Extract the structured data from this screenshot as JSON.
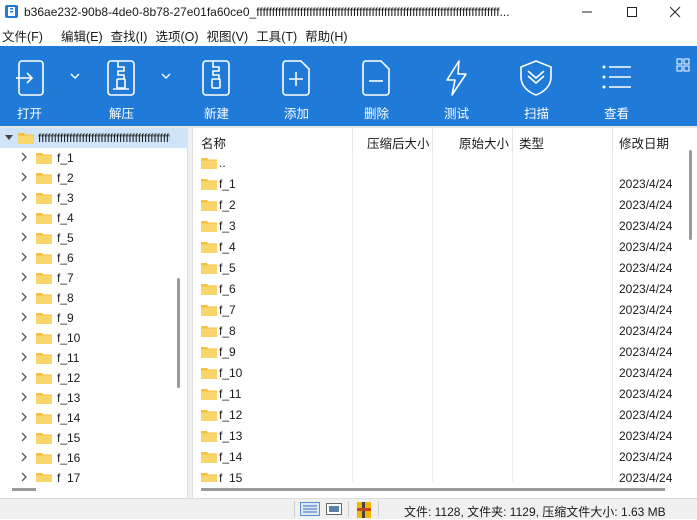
{
  "window": {
    "title": "b36ae232-90b8-4de0-8b78-27e01fa60ce0_ffffffffffffffffffffffffffffffffffffffffffffffffffffffffffffffffffffffffffffff..."
  },
  "menu": [
    "文件(F)",
    "编辑(E)",
    "查找(I)",
    "选项(O)",
    "视图(V)",
    "工具(T)",
    "帮助(H)"
  ],
  "toolbar": {
    "open": "打开",
    "extract": "解压",
    "new": "新建",
    "add": "添加",
    "delete": "删除",
    "test": "测试",
    "scan": "扫描",
    "view": "查看"
  },
  "tree": {
    "root": "ffffffffffffffffffffffffffffffffffffffffffffffff",
    "items": [
      "f_1",
      "f_2",
      "f_3",
      "f_4",
      "f_5",
      "f_6",
      "f_7",
      "f_8",
      "f_9",
      "f_10",
      "f_11",
      "f_12",
      "f_13",
      "f_14",
      "f_15",
      "f_16",
      "f_17"
    ]
  },
  "list": {
    "columns": [
      "名称",
      "压缩后大小",
      "原始大小",
      "类型",
      "修改日期"
    ],
    "up_label": "..",
    "rows": [
      {
        "name": "f_1",
        "date": "2023/4/24"
      },
      {
        "name": "f_2",
        "date": "2023/4/24"
      },
      {
        "name": "f_3",
        "date": "2023/4/24"
      },
      {
        "name": "f_4",
        "date": "2023/4/24"
      },
      {
        "name": "f_5",
        "date": "2023/4/24"
      },
      {
        "name": "f_6",
        "date": "2023/4/24"
      },
      {
        "name": "f_7",
        "date": "2023/4/24"
      },
      {
        "name": "f_8",
        "date": "2023/4/24"
      },
      {
        "name": "f_9",
        "date": "2023/4/24"
      },
      {
        "name": "f_10",
        "date": "2023/4/24"
      },
      {
        "name": "f_11",
        "date": "2023/4/24"
      },
      {
        "name": "f_12",
        "date": "2023/4/24"
      },
      {
        "name": "f_13",
        "date": "2023/4/24"
      },
      {
        "name": "f_14",
        "date": "2023/4/24"
      },
      {
        "name": "f_15",
        "date": "2023/4/24"
      }
    ]
  },
  "status": {
    "text": "文件: 1128, 文件夹: 1129, 压缩文件大小: 1.63 MB"
  },
  "colors": {
    "toolbar": "#1f7ad8",
    "folder": "#f5c142",
    "selection": "#cfe4f9"
  }
}
